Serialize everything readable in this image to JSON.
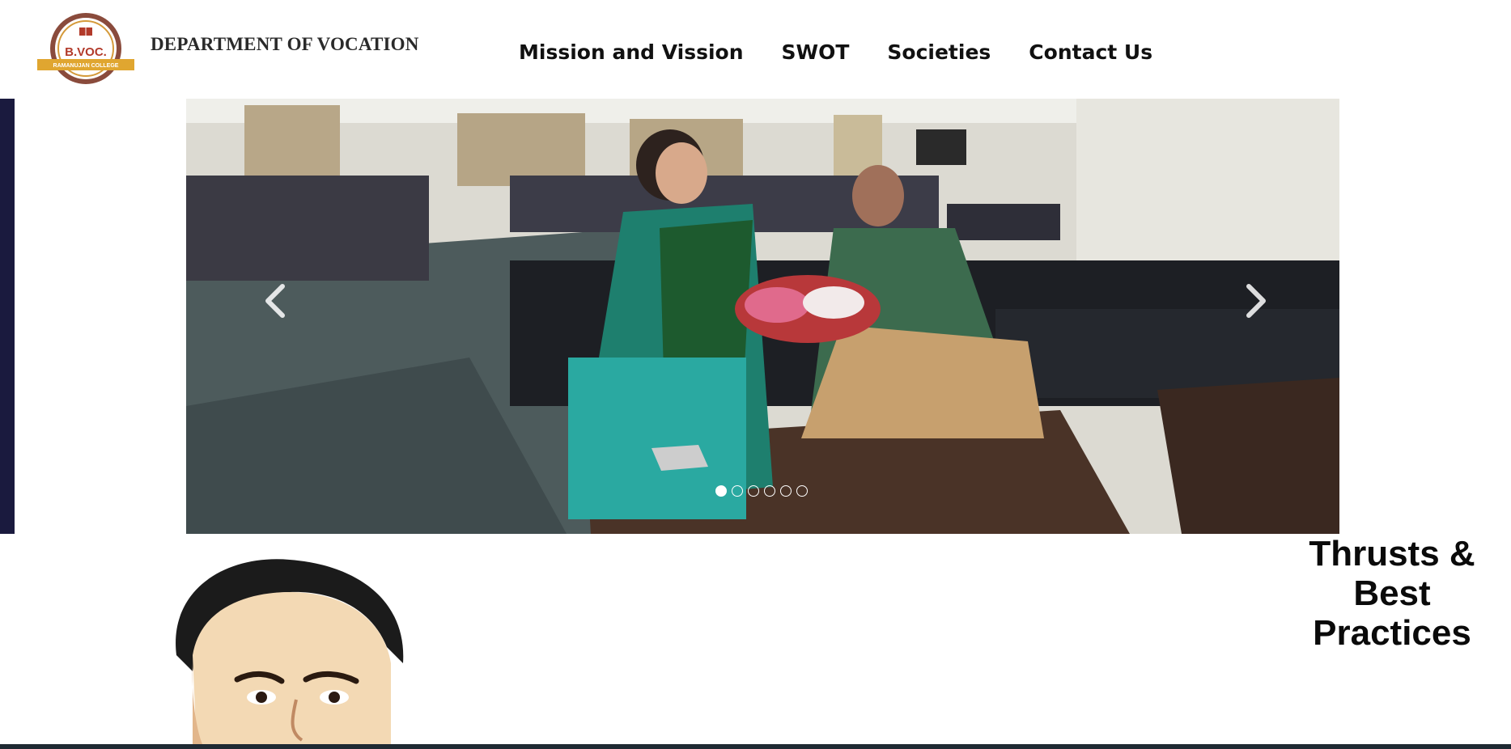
{
  "header": {
    "logo": {
      "text_main": "B.VOC.",
      "text_ribbon": "RAMANUJAN COLLEGE",
      "colors": {
        "ring": "#8a4b3c",
        "ribbon": "#e0a630",
        "main_text": "#b23a2a"
      }
    },
    "department_title": "DEPARTMENT OF VOCATION"
  },
  "nav": {
    "items": [
      {
        "label": "Mission and Vission"
      },
      {
        "label": "SWOT"
      },
      {
        "label": "Societies"
      },
      {
        "label": "Contact Us"
      }
    ]
  },
  "carousel": {
    "slide_count": 6,
    "active_index": 0,
    "prev_icon": "chevron-left-icon",
    "next_icon": "chevron-right-icon"
  },
  "thrusts": {
    "line1": "Thrusts &",
    "line2": "Best",
    "line3": "Practices"
  },
  "colors": {
    "left_strip": "#1a1a3e",
    "bottom_bar": "#1f2a33"
  }
}
